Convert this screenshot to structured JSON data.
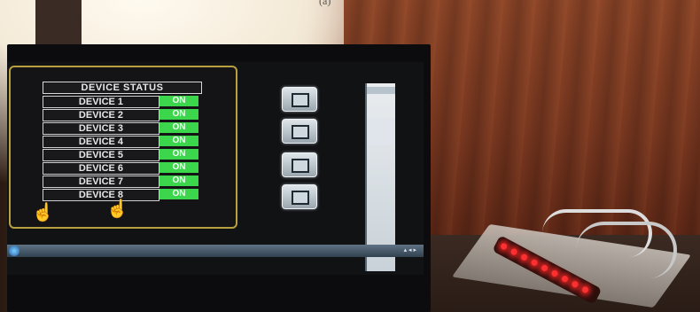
{
  "caption_mark": "(a)",
  "panel": {
    "title": "DEVICE STATUS",
    "devices": [
      {
        "name": "DEVICE 1",
        "state": "ON"
      },
      {
        "name": "DEVICE 2",
        "state": "ON"
      },
      {
        "name": "DEVICE 3",
        "state": "ON"
      },
      {
        "name": "DEVICE 4",
        "state": "ON"
      },
      {
        "name": "DEVICE 5",
        "state": "ON"
      },
      {
        "name": "DEVICE 6",
        "state": "ON"
      },
      {
        "name": "DEVICE 7",
        "state": "ON"
      },
      {
        "name": "DEVICE 8",
        "state": "ON"
      }
    ]
  },
  "buttons": [
    "button-1",
    "button-2",
    "button-3",
    "button-4"
  ],
  "icons": {
    "hand_left": "pointing-hand-icon",
    "hand_right": "pointing-hand-icon",
    "button": "square-icon"
  },
  "colors": {
    "on_state": "#3bd64b",
    "panel_border": "#b8a040",
    "led": "#ff3030"
  },
  "led_count": 9
}
